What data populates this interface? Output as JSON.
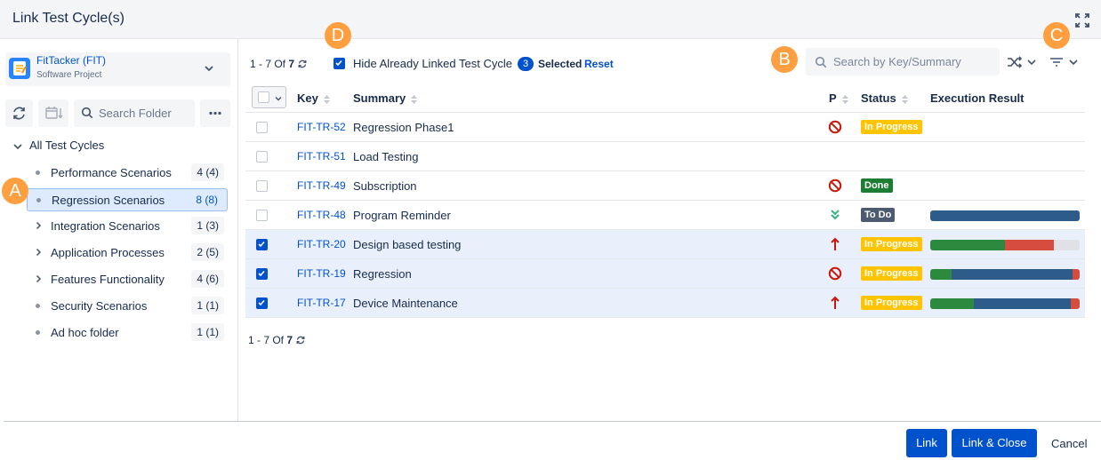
{
  "dialog": {
    "title": "Link Test Cycle(s)"
  },
  "project": {
    "name": "FitTacker (FIT)",
    "subtitle": "Software Project"
  },
  "folder_search": {
    "placeholder": "Search Folder"
  },
  "tree": {
    "root": "All Test Cycles",
    "items": [
      {
        "label": "Performance Scenarios",
        "count": "4 (4)",
        "has_children": false
      },
      {
        "label": "Regression Scenarios",
        "count": "8 (8)",
        "has_children": false
      },
      {
        "label": "Integration Scenarios",
        "count": "1 (3)",
        "has_children": true
      },
      {
        "label": "Application Processes",
        "count": "2 (5)",
        "has_children": true
      },
      {
        "label": "Features Functionality",
        "count": "4 (6)",
        "has_children": true
      },
      {
        "label": "Security Scenarios",
        "count": "1 (1)",
        "has_children": false
      },
      {
        "label": "Ad hoc folder",
        "count": "1 (1)",
        "has_children": false
      }
    ]
  },
  "callouts": {
    "a": "A",
    "b": "B",
    "c": "C",
    "d": "D"
  },
  "pagination": {
    "range": "1 - 7 Of",
    "total": "7"
  },
  "hide_linked": {
    "label": "Hide Already Linked Test Cycle"
  },
  "selection": {
    "count": "3",
    "label": "Selected",
    "reset": "Reset"
  },
  "search": {
    "placeholder": "Search by Key/Summary"
  },
  "columns": {
    "key": "Key",
    "summary": "Summary",
    "priority": "P",
    "status": "Status",
    "exec": "Execution Result"
  },
  "colors": {
    "exec_pass": "#2b8a3e",
    "exec_fail": "#d64c3e",
    "exec_unexecuted": "#2d5b8a",
    "exec_remaining": "#dfe1e6",
    "prio_red": "#c9190b",
    "prio_green": "#36b37e"
  },
  "rows": [
    {
      "key": "FIT-TR-52",
      "summary": "Regression Phase1",
      "priority": "blocker-icon",
      "status": "In Progress",
      "status_type": "progress",
      "exec": null,
      "checked": false
    },
    {
      "key": "FIT-TR-51",
      "summary": "Load Testing",
      "priority": null,
      "status": null,
      "status_type": null,
      "exec": null,
      "checked": false
    },
    {
      "key": "FIT-TR-49",
      "summary": "Subscription",
      "priority": "blocker-icon",
      "status": "Done",
      "status_type": "done",
      "exec": null,
      "checked": false
    },
    {
      "key": "FIT-TR-48",
      "summary": "Program Reminder",
      "priority": "lowest-icon",
      "status": "To Do",
      "status_type": "todo",
      "exec": [
        {
          "kind": "unexecuted",
          "frac": 1.0
        }
      ],
      "checked": false
    },
    {
      "key": "FIT-TR-20",
      "summary": "Design based testing",
      "priority": "highest-icon",
      "status": "In Progress",
      "status_type": "progress",
      "exec": [
        {
          "kind": "pass",
          "frac": 0.5
        },
        {
          "kind": "fail",
          "frac": 0.33
        },
        {
          "kind": "remaining",
          "frac": 0.17
        }
      ],
      "checked": true
    },
    {
      "key": "FIT-TR-19",
      "summary": "Regression",
      "priority": "blocker-icon",
      "status": "In Progress",
      "status_type": "progress",
      "exec": [
        {
          "kind": "pass",
          "frac": 0.14
        },
        {
          "kind": "unexecuted",
          "frac": 0.81
        },
        {
          "kind": "fail",
          "frac": 0.05
        }
      ],
      "checked": true
    },
    {
      "key": "FIT-TR-17",
      "summary": "Device Maintenance",
      "priority": "highest-icon",
      "status": "In Progress",
      "status_type": "progress",
      "exec": [
        {
          "kind": "pass",
          "frac": 0.29
        },
        {
          "kind": "unexecuted",
          "frac": 0.65
        },
        {
          "kind": "fail",
          "frac": 0.06
        }
      ],
      "checked": true
    }
  ],
  "footer": {
    "link": "Link",
    "link_close": "Link & Close",
    "cancel": "Cancel"
  }
}
